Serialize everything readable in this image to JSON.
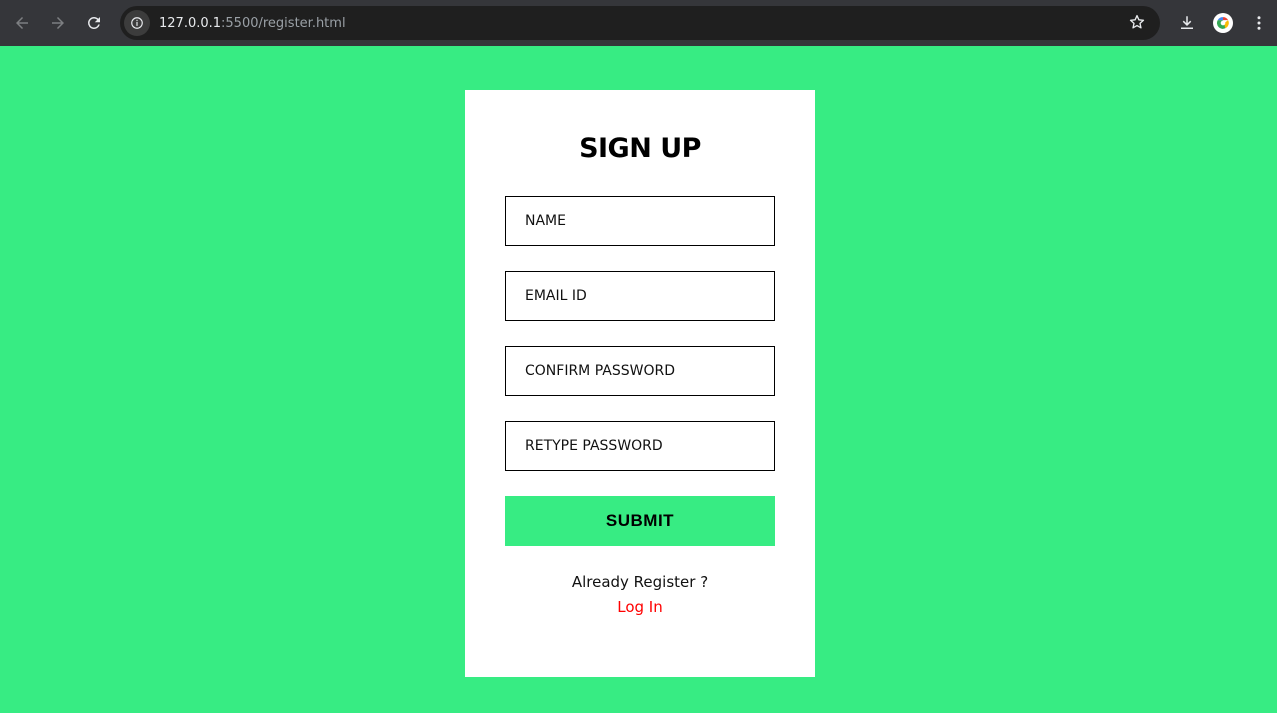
{
  "browser": {
    "url_host": "127.0.0.1",
    "url_rest": ":5500/register.html"
  },
  "form": {
    "title": "SIGN UP",
    "fields": [
      {
        "placeholder": "NAME"
      },
      {
        "placeholder": "EMAIL ID"
      },
      {
        "placeholder": "CONFIRM PASSWORD"
      },
      {
        "placeholder": "RETYPE PASSWORD"
      }
    ],
    "submit_label": "SUBMIT",
    "already_text": "Already Register ?",
    "login_link": "Log In"
  },
  "colors": {
    "background": "#37ec83",
    "card": "#ffffff",
    "link": "#ff0000"
  }
}
